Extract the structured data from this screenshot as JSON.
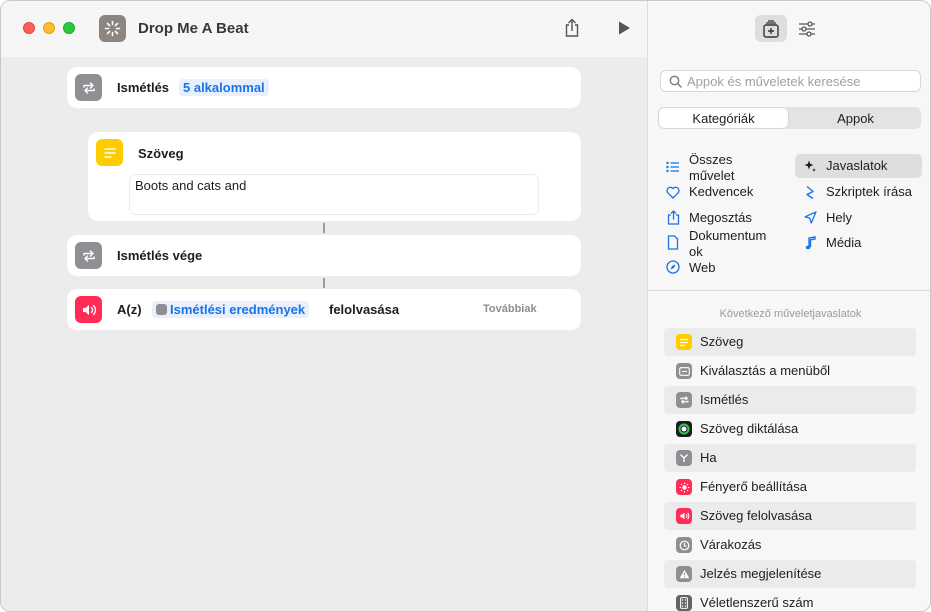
{
  "window": {
    "title": "Drop Me A Beat"
  },
  "editor": {
    "repeat": {
      "label": "Ismétlés",
      "count_token": "5 alkalommal"
    },
    "text_action": {
      "label": "Szöveg",
      "value": "Boots and cats and"
    },
    "repeat_end": {
      "label": "Ismétlés vége"
    },
    "speak": {
      "prefix": "A(z)",
      "token": "Ismétlési eredmények",
      "suffix": "felolvasása",
      "more": "Továbbiak"
    }
  },
  "library": {
    "search_placeholder": "Appok és műveletek keresése",
    "segments": [
      "Kategóriák",
      "Appok"
    ],
    "categories_left": [
      {
        "label": "Összes\nművelet",
        "icon": "list-icon"
      },
      {
        "label": "Kedvencek",
        "icon": "heart-icon"
      },
      {
        "label": "Megosztás",
        "icon": "share-icon"
      },
      {
        "label": "Dokumentum\nok",
        "icon": "document-icon"
      },
      {
        "label": "Web",
        "icon": "compass-icon"
      }
    ],
    "categories_right": [
      {
        "label": "Javaslatok",
        "icon": "sparkle-icon"
      },
      {
        "label": "Szkriptek írása",
        "icon": "script-icon"
      },
      {
        "label": "Hely",
        "icon": "location-icon"
      },
      {
        "label": "Média",
        "icon": "music-icon"
      }
    ],
    "suggestions_heading": "Következő műveletjavaslatok",
    "suggestions": [
      {
        "label": "Szöveg",
        "icon": "text-icon",
        "color": "#ffcc00"
      },
      {
        "label": "Kiválasztás a menüből",
        "icon": "menu-icon",
        "color": "#8e8e93"
      },
      {
        "label": "Ismétlés",
        "icon": "repeat-icon",
        "color": "#8e8e93"
      },
      {
        "label": "Szöveg diktálása",
        "icon": "dictate-icon",
        "color": "#1c1c1e"
      },
      {
        "label": "Ha",
        "icon": "if-icon",
        "color": "#8e8e93"
      },
      {
        "label": "Fényerő beállítása",
        "icon": "brightness-icon",
        "color": "#ff2d55"
      },
      {
        "label": "Szöveg felolvasása",
        "icon": "speaker-icon",
        "color": "#ff2d55"
      },
      {
        "label": "Várakozás",
        "icon": "timer-icon",
        "color": "#8e8e93"
      },
      {
        "label": "Jelzés megjelenítése",
        "icon": "alert-icon",
        "color": "#8e8e93"
      },
      {
        "label": "Véletlenszerű szám",
        "icon": "random-icon",
        "color": "#636366"
      }
    ]
  },
  "colors": {
    "accent": "#1a73e8",
    "token_bg": "#e8f0fd"
  }
}
